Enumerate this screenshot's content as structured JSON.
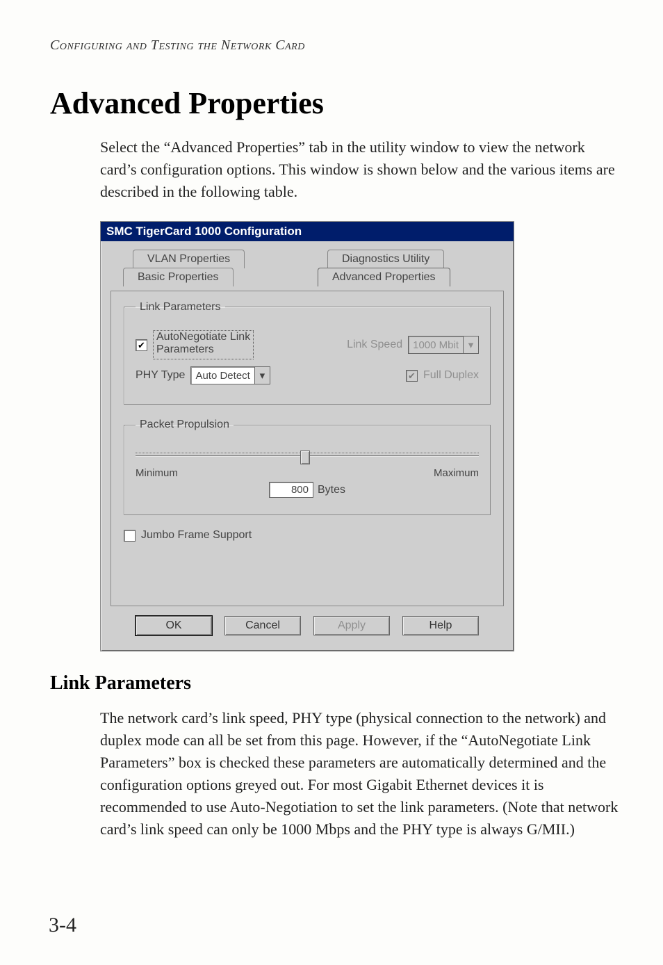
{
  "running_header": "Configuring and Testing the Network Card",
  "title": "Advanced Properties",
  "intro": "Select the “Advanced Properties” tab in the utility window to view the network card’s configuration options. This window is shown below and the various items are described in the following table.",
  "section2_title": "Link Parameters",
  "section2_body": "The network card’s link speed, PHY type (physical connection to the network) and duplex mode can all be set from this page. However, if the “AutoNegotiate Link Parameters” box is checked these parameters are automatically determined and the configuration options greyed out. For most Gigabit Ethernet devices it is recommended to use Auto-Negotiation to set the link parameters. (Note that network card’s link speed can only be 1000 Mbps and the PHY type is always G/MII.)",
  "page_number": "3-4",
  "dialog": {
    "title": "SMC TigerCard 1000 Configuration",
    "tabs": {
      "back_left": "VLAN Properties",
      "back_right": "Diagnostics Utility",
      "front_left": "Basic Properties",
      "front_right": "Advanced Properties"
    },
    "link_params": {
      "legend": "Link Parameters",
      "autoneg_label_line1": "AutoNegotiate Link",
      "autoneg_label_line2": "Parameters",
      "autoneg_checked": true,
      "link_speed_label": "Link Speed",
      "link_speed_value": "1000 Mbit",
      "phy_label": "PHY Type",
      "phy_value": "Auto Detect",
      "full_duplex_label": "Full Duplex",
      "full_duplex_checked": true
    },
    "packet": {
      "legend": "Packet Propulsion",
      "min_label": "Minimum",
      "max_label": "Maximum",
      "value": "800",
      "unit": "Bytes"
    },
    "jumbo": {
      "label": "Jumbo Frame Support",
      "checked": false
    },
    "buttons": {
      "ok": "OK",
      "cancel": "Cancel",
      "apply": "Apply",
      "help": "Help"
    }
  }
}
